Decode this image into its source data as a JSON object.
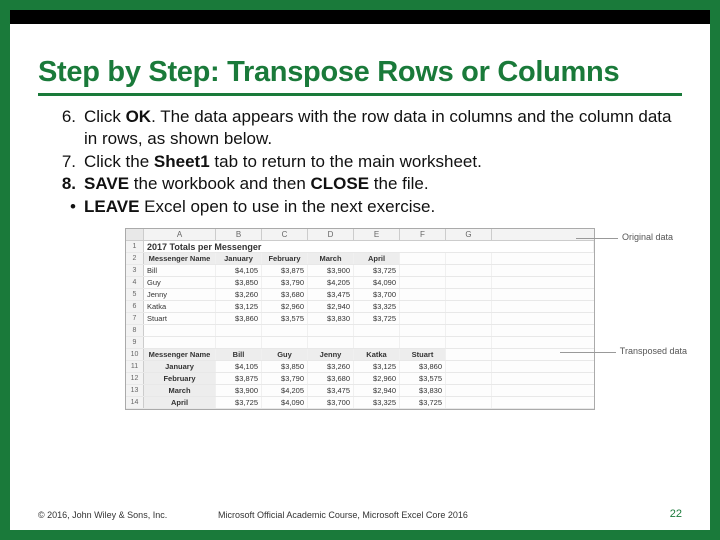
{
  "title": "Step by Step: Transpose Rows or Columns",
  "steps": [
    {
      "num": "6.",
      "html": [
        "Click ",
        {
          "b": "OK"
        },
        ". The data appears with the row data in columns and the column data in rows, as shown below."
      ]
    },
    {
      "num": "7.",
      "html": [
        "Click the ",
        {
          "b": "Sheet1"
        },
        " tab to return to the main worksheet."
      ]
    },
    {
      "num": "8.",
      "bold_num": true,
      "html": [
        {
          "b": "SAVE"
        },
        " the workbook and then ",
        {
          "b": "CLOSE"
        },
        " the file."
      ]
    },
    {
      "num": "•",
      "html": [
        {
          "b": "LEAVE"
        },
        " Excel open to use in the next exercise."
      ]
    }
  ],
  "footer": {
    "left": "© 2016, John Wiley & Sons, Inc.",
    "mid": "Microsoft Official Academic Course, Microsoft Excel Core 2016",
    "page": "22"
  },
  "callouts": {
    "original": "Original data",
    "transposed": "Transposed data"
  },
  "chart_data": {
    "type": "table",
    "title": "2017 Totals per Messenger",
    "columns_letters": [
      "A",
      "B",
      "C",
      "D",
      "E",
      "F",
      "G"
    ],
    "original": {
      "headers": [
        "Messenger Name",
        "January",
        "February",
        "March",
        "April"
      ],
      "rows": [
        {
          "name": "Bill",
          "values": [
            "$4,105",
            "$3,875",
            "$3,900",
            "$3,725"
          ]
        },
        {
          "name": "Guy",
          "values": [
            "$3,850",
            "$3,790",
            "$4,205",
            "$4,090"
          ]
        },
        {
          "name": "Jenny",
          "values": [
            "$3,260",
            "$3,680",
            "$3,475",
            "$3,700"
          ]
        },
        {
          "name": "Katka",
          "values": [
            "$3,125",
            "$2,960",
            "$2,940",
            "$3,325"
          ]
        },
        {
          "name": "Stuart",
          "values": [
            "$3,860",
            "$3,575",
            "$3,830",
            "$3,725"
          ]
        }
      ]
    },
    "transposed": {
      "headers": [
        "Messenger Name",
        "Bill",
        "Guy",
        "Jenny",
        "Katka",
        "Stuart"
      ],
      "rows": [
        {
          "name": "January",
          "values": [
            "$4,105",
            "$3,850",
            "$3,260",
            "$3,125",
            "$3,860"
          ]
        },
        {
          "name": "February",
          "values": [
            "$3,875",
            "$3,790",
            "$3,680",
            "$2,960",
            "$3,575"
          ]
        },
        {
          "name": "March",
          "values": [
            "$3,900",
            "$4,205",
            "$3,475",
            "$2,940",
            "$3,830"
          ]
        },
        {
          "name": "April",
          "values": [
            "$3,725",
            "$4,090",
            "$3,700",
            "$3,325",
            "$3,725"
          ]
        }
      ]
    }
  }
}
